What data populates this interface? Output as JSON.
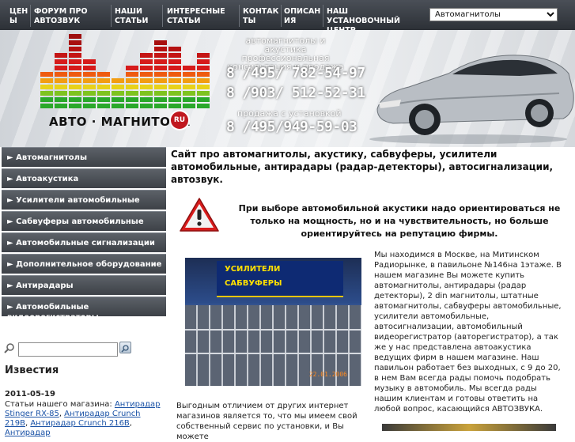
{
  "nav": {
    "items": [
      {
        "label": "ЦЕНЫ"
      },
      {
        "label": "ФОРУМ ПРО АВТОЗВУК"
      },
      {
        "label": "НАШИ СТАТЬИ"
      },
      {
        "label": "ИНТЕРЕСНЫЕ СТАТЬИ"
      },
      {
        "label": "КОНТАКТЫ"
      },
      {
        "label": "ОПИСАНИЯ"
      },
      {
        "label": "НАШ УСТАНОВОЧНЫЙ ЦЕНТР"
      }
    ],
    "select_value": "Автомагнитолы"
  },
  "header": {
    "tagline": "автомагнитолы и акустика профессиональная консультация и продажа",
    "phone1": "8 /495/ 782-54-97",
    "phone2": "8 /903/ 512-52-31",
    "install_label": "продажа с установкой",
    "phone3": "8 /495/949-59-03",
    "logo_text": "АВТО · МАГНИТОЛА",
    "logo_ru": "RU"
  },
  "sidebar": {
    "menu": [
      {
        "label": "► Автомагнитолы"
      },
      {
        "label": "► Автоакустика"
      },
      {
        "label": "► Усилители автомобильные"
      },
      {
        "label": "► Сабвуферы автомобильные"
      },
      {
        "label": "► Автомобильные сигнализации"
      },
      {
        "label": "► Дополнительное оборудование"
      },
      {
        "label": "► Антирадары"
      },
      {
        "label": "► Автомобильные видеорегистраторы"
      }
    ],
    "news": {
      "title": "Известия",
      "date": "2011-05-19",
      "text_prefix": "Статьи нашего магазина: ",
      "links": [
        "Антирадар Stinger RX-85",
        "Антирадар Crunch 219B",
        "Антирадар Crunch 216B",
        "Антирадар"
      ]
    }
  },
  "content": {
    "intro": "Сайт про автомагнитолы, акустику, сабвуферы, усилители автомобильные, антирадары (радар-детекторы), автосигнализации, автозвук.",
    "warning": "При выборе автомобильной акустики надо ориентироваться не только на мощность, но и на чувствительность, но больше ориентируйтесь на репутацию фирмы.",
    "photo_sign1": "УСИЛИТЕЛИ",
    "photo_sign2": "САБВУФЕРЫ",
    "photo_date": "22.01.2006",
    "about": "Мы находимся в Москве, на Митинском Радиорынке, в павильоне №146на 1этаже. В нашем магазине Вы можете купить автомагнитолы, антирадары (радар детекторы), 2 din магнитолы, штатные автомагнитолы, сабвуферы автомобильные, усилители автомобильные, автосигнализации, автомобильный видеорегистратор (авторегистратор), а так же у нас представлена автоакустика ведущих фирм в нашем магазине. Наш павильон работает без выходных, с 9 до 20, в нем Вам всегда рады помочь подобрать музыку в автомобиль. Мы всегда рады нашим клиентам и готовы ответить на любой вопрос, касающийся АВТОЗВУКА.",
    "bottom": "Выгодным отличием от других интернет магазинов является то, что мы имеем свой собственный сервис по установки, и Вы можете"
  },
  "colors": {
    "nav_bg": "#383c42",
    "menu_bg": "#4a4f56",
    "link": "#1a52a6",
    "logo_red": "#c0181f"
  }
}
